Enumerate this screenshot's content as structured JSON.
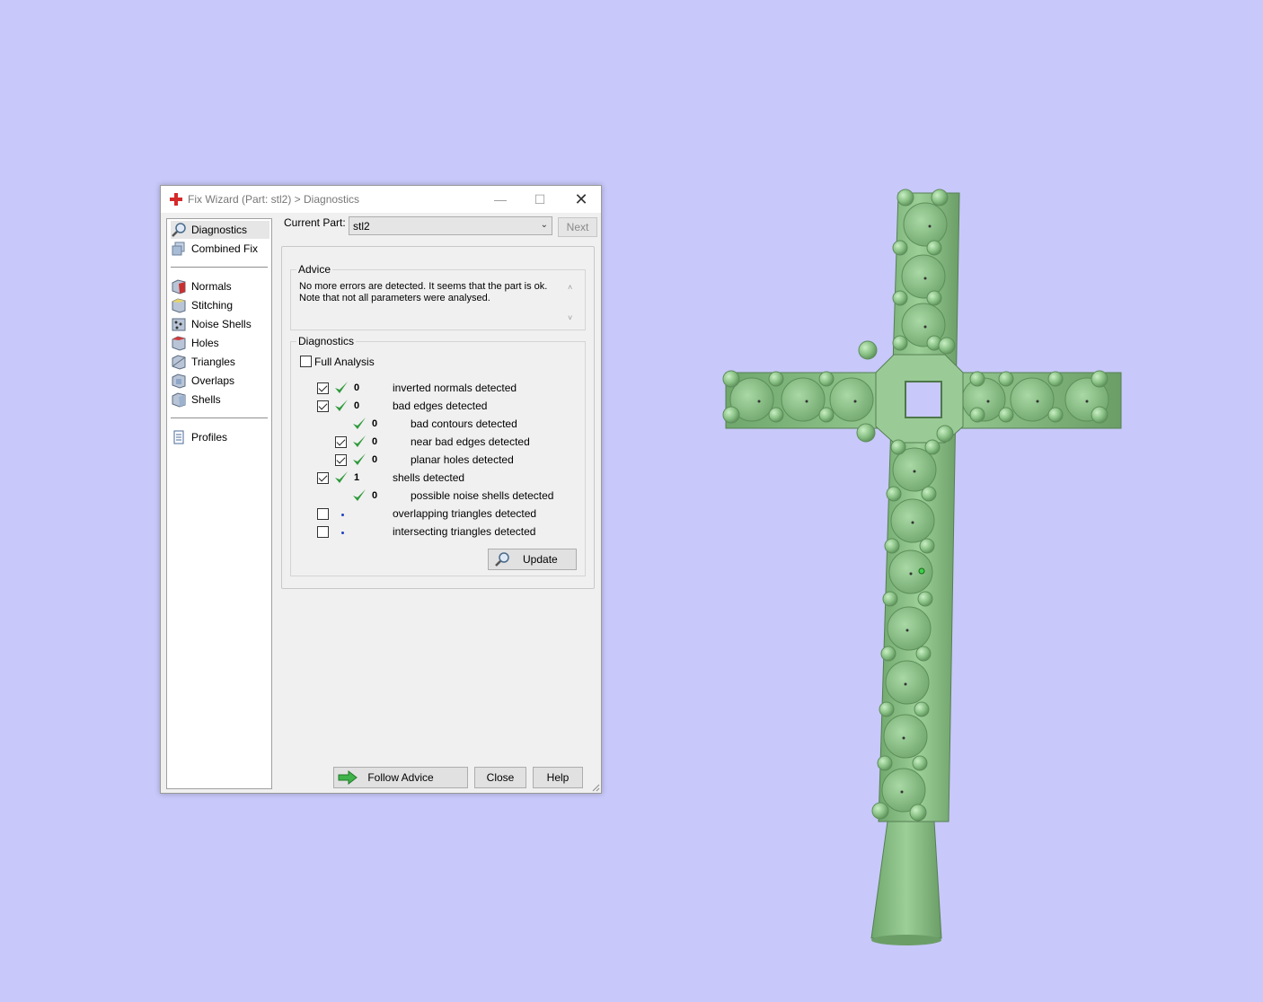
{
  "window": {
    "title": "Fix Wizard (Part: stl2) > Diagnostics",
    "minimize_glyph": "—",
    "maximize_glyph": "☐",
    "close_glyph": "✕"
  },
  "sidebar": {
    "items": [
      {
        "label": "Diagnostics",
        "icon": "magnifier-icon",
        "selected": true
      },
      {
        "label": "Combined Fix",
        "icon": "cube-stack-icon"
      },
      {
        "label": "Normals",
        "icon": "normals-cube-icon"
      },
      {
        "label": "Stitching",
        "icon": "stitching-cube-icon"
      },
      {
        "label": "Noise Shells",
        "icon": "noise-shells-icon"
      },
      {
        "label": "Holes",
        "icon": "holes-cube-icon"
      },
      {
        "label": "Triangles",
        "icon": "triangles-cube-icon"
      },
      {
        "label": "Overlaps",
        "icon": "overlaps-cube-icon"
      },
      {
        "label": "Shells",
        "icon": "shells-cube-icon"
      },
      {
        "label": "Profiles",
        "icon": "document-icon"
      }
    ]
  },
  "current_part": {
    "label": "Current Part:",
    "value": "stl2",
    "next_label": "Next"
  },
  "advice": {
    "title": "Advice",
    "line1": "No more errors are detected. It seems that the part is ok.",
    "line2": "Note that not all parameters were analysed.",
    "scroll_up": "˄",
    "scroll_down": "˅"
  },
  "diagnostics": {
    "title": "Diagnostics",
    "full_analysis_label": "Full Analysis",
    "full_analysis_checked": false,
    "rows": [
      {
        "count": "0",
        "label": "inverted normals detected",
        "checked": true
      },
      {
        "count": "0",
        "label": "bad edges detected",
        "checked": true
      },
      {
        "count": "0",
        "label": "bad contours detected"
      },
      {
        "count": "0",
        "label": "near bad edges detected",
        "checked": true
      },
      {
        "count": "0",
        "label": "planar holes detected",
        "checked": true
      },
      {
        "count": "1",
        "label": "shells detected",
        "checked": true
      },
      {
        "count": "0",
        "label": "possible noise shells detected"
      },
      {
        "count": "",
        "label": "overlapping triangles detected",
        "checked": false
      },
      {
        "count": "",
        "label": "intersecting triangles detected",
        "checked": false
      }
    ],
    "update_label": "Update"
  },
  "footer": {
    "follow_label": "Follow Advice",
    "close_label": "Close",
    "help_label": "Help"
  },
  "colors": {
    "viewport_bg": "#c8c8fa",
    "model_green": "#8cc48a",
    "check_green": "#2e9a3a"
  }
}
